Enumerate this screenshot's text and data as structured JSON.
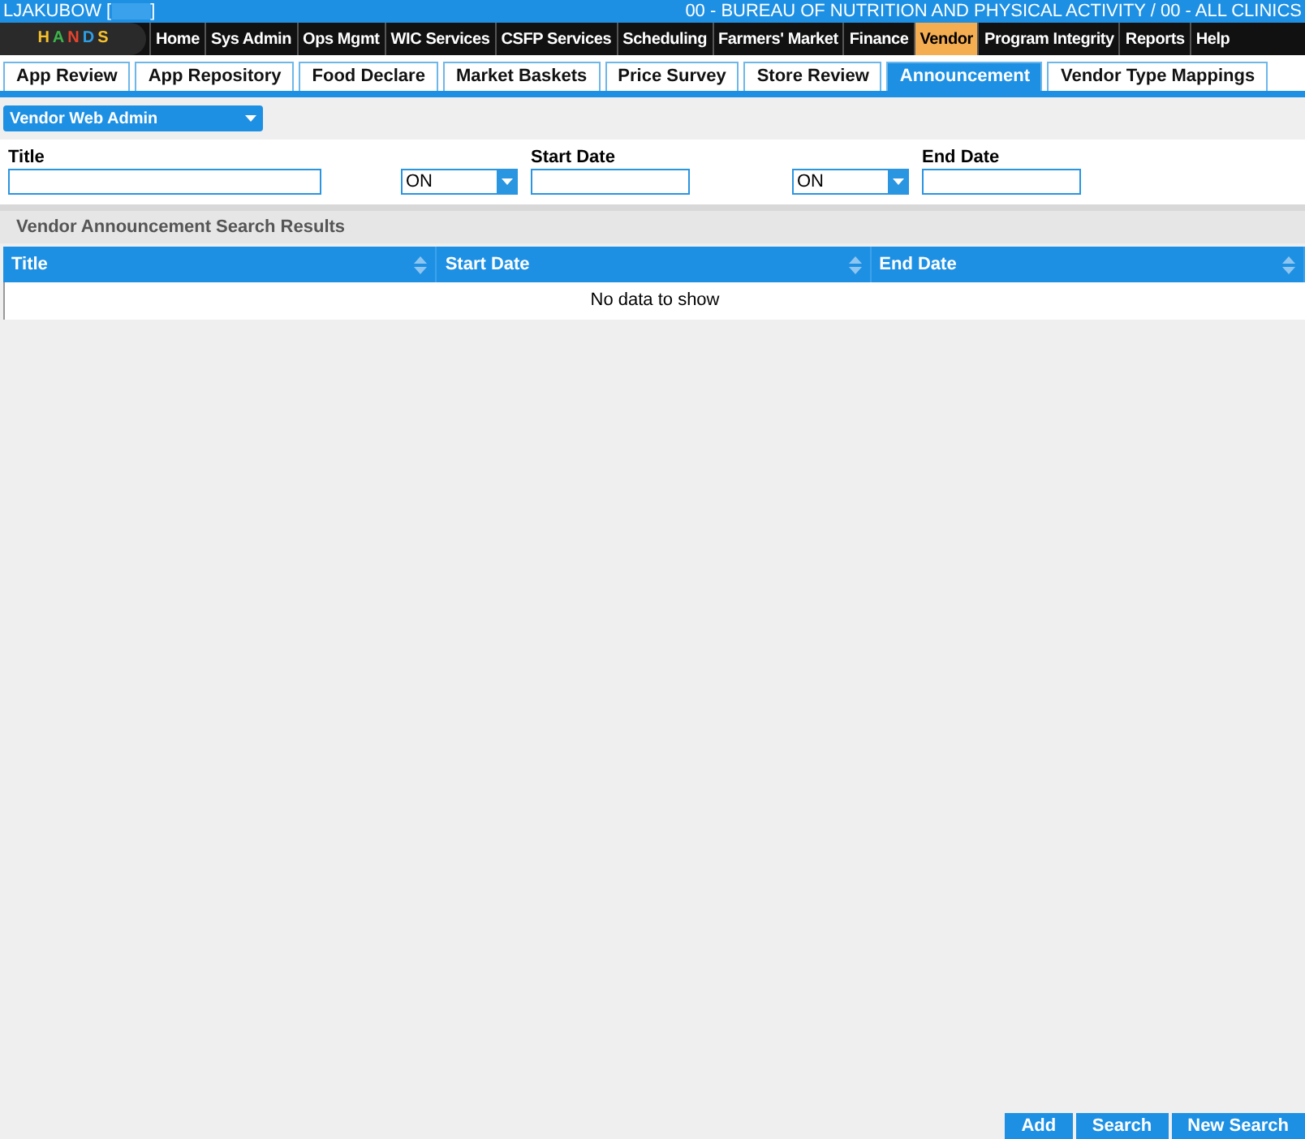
{
  "header": {
    "user": "LJAKUBOW",
    "bracket_open": "[",
    "bracket_close": "]",
    "agency": "00 - BUREAU OF NUTRITION AND PHYSICAL ACTIVITY / 00 - ALL CLINICS"
  },
  "logo": {
    "letters": [
      "H",
      "A",
      "N",
      "D",
      "S"
    ]
  },
  "nav": [
    {
      "label": "Home",
      "selected": false
    },
    {
      "label": "Sys Admin",
      "selected": false
    },
    {
      "label": "Ops Mgmt",
      "selected": false
    },
    {
      "label": "WIC Services",
      "selected": false
    },
    {
      "label": "CSFP Services",
      "selected": false
    },
    {
      "label": "Scheduling",
      "selected": false
    },
    {
      "label": "Farmers' Market",
      "selected": false
    },
    {
      "label": "Finance",
      "selected": false
    },
    {
      "label": "Vendor",
      "selected": true
    },
    {
      "label": "Program Integrity",
      "selected": false
    },
    {
      "label": "Reports",
      "selected": false
    },
    {
      "label": "Help",
      "selected": false
    }
  ],
  "tabs": [
    {
      "label": "App Review",
      "selected": false
    },
    {
      "label": "App Repository",
      "selected": false
    },
    {
      "label": "Food Declare",
      "selected": false
    },
    {
      "label": "Market Baskets",
      "selected": false
    },
    {
      "label": "Price Survey",
      "selected": false
    },
    {
      "label": "Store Review",
      "selected": false
    },
    {
      "label": "Announcement",
      "selected": true
    },
    {
      "label": "Vendor Type Mappings",
      "selected": false
    }
  ],
  "module_select": {
    "value": "Vendor Web Admin"
  },
  "filters": {
    "title_label": "Title",
    "start_op": "ON",
    "start_label": "Start Date",
    "end_op": "ON",
    "end_label": "End Date"
  },
  "results": {
    "title": "Vendor Announcement Search Results",
    "columns": [
      "Title",
      "Start Date",
      "End Date"
    ],
    "empty": "No data to show"
  },
  "buttons": [
    "Add",
    "Search",
    "New Search"
  ]
}
